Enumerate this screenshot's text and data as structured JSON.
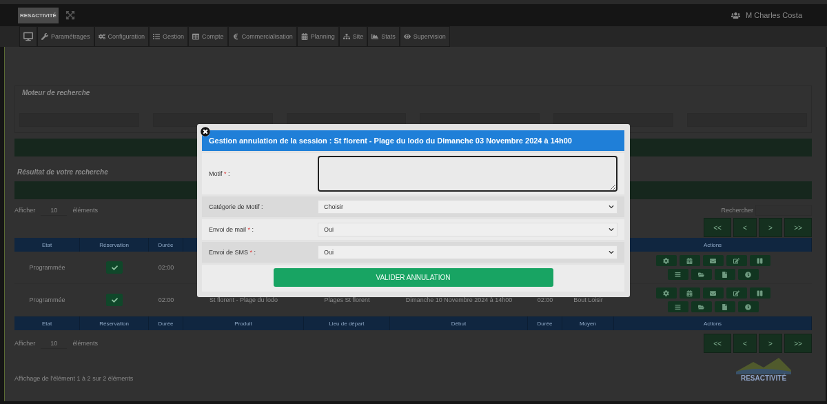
{
  "topbar": {
    "logo": "RESACTIVITÉ",
    "user": "M Charles Costa"
  },
  "nav": [
    {
      "label": "Paramétrages"
    },
    {
      "label": "Configuration"
    },
    {
      "label": "Gestion"
    },
    {
      "label": "Compte"
    },
    {
      "label": "Commercialisation"
    },
    {
      "label": "Planning"
    },
    {
      "label": "Site"
    },
    {
      "label": "Stats"
    },
    {
      "label": "Supervision"
    }
  ],
  "search_panel": {
    "title": "Moteur de recherche"
  },
  "results": {
    "title": "Résultat de votre recherche",
    "top": {
      "show_label": "Afficher",
      "show_count": "10",
      "show_suffix": "éléments",
      "search_label": "Rechercher",
      "pages": [
        "<<",
        "<",
        ">",
        ">>"
      ]
    },
    "bottom": {
      "show_label": "Afficher",
      "show_count": "10",
      "show_suffix": "éléments",
      "pages": [
        "<<",
        "<",
        ">",
        ">>"
      ]
    },
    "info": "Affichage de l'élément 1 à 2 sur 2 éléments"
  },
  "table": {
    "head": [
      {
        "label": "Etat"
      },
      {
        "label": "Réservation"
      },
      {
        "label": "Durée"
      },
      {
        "label": "Actions"
      }
    ],
    "rows": [
      {
        "etat": "Programmée",
        "booked": true,
        "duree": "02:00"
      },
      {
        "etat": "Programmée",
        "booked": true,
        "duree": "02:00",
        "produit": "St florent - Plage du lodo",
        "lieu": "Plages St florent",
        "debut": "Dimanche 10 Novembre 2024 à 14h00",
        "duree2": "02:00",
        "moyen": "Bout Loisir"
      }
    ],
    "foot": [
      {
        "label": "Etat"
      },
      {
        "label": "Réservation"
      },
      {
        "label": "Durée"
      },
      {
        "label": "Produit"
      },
      {
        "label": "Lieu de départ"
      },
      {
        "label": "Début"
      },
      {
        "label": "Durée"
      },
      {
        "label": "Moyen"
      },
      {
        "label": "Actions"
      }
    ]
  },
  "footer_logo": "RESACTIVITÉ",
  "modal": {
    "title": "Gestion annulation de la session : St florent - Plage du lodo du Dimanche 03 Novembre 2024 à 14h00",
    "fields": [
      {
        "kind": "textarea",
        "label": "Motif",
        "required_mark": "*",
        "colon": ":"
      },
      {
        "kind": "select",
        "label": "Catégorie de Motif",
        "colon": ":",
        "value": "Choisir"
      },
      {
        "kind": "select",
        "label": "Envoi de mail",
        "required_mark": "*",
        "colon": ":",
        "value": "Oui"
      },
      {
        "kind": "select",
        "label": "Envoi de SMS",
        "required_mark": "*",
        "colon": ":",
        "value": "Oui"
      }
    ],
    "submit": "VALIDER ANNULATION"
  }
}
